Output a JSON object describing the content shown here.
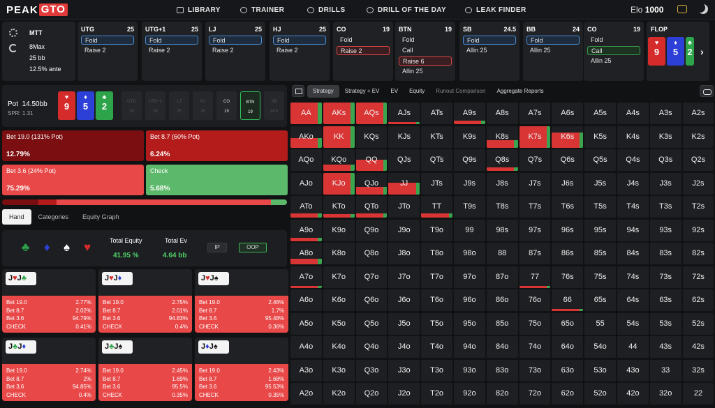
{
  "header": {
    "logo_left": "PEAK",
    "logo_right": "GTO",
    "nav": [
      {
        "label": "LIBRARY",
        "icon": "library-icon"
      },
      {
        "label": "TRAINER",
        "icon": "gamepad-icon"
      },
      {
        "label": "DRILLS",
        "icon": "drills-icon"
      },
      {
        "label": "DRILL OF THE DAY",
        "icon": "plus-circle-icon"
      },
      {
        "label": "LEAK FINDER",
        "icon": "leak-finder-icon"
      }
    ],
    "elo_label": "Elo",
    "elo_value": "1000"
  },
  "game_info": {
    "format": "MTT",
    "players": "8Max",
    "stack": "25 bb",
    "ante": "12.5% ante"
  },
  "seats": [
    {
      "pos": "UTG",
      "stack": "25",
      "actions": [
        {
          "t": "Fold",
          "h": "blue"
        },
        {
          "t": "Raise 2",
          "h": ""
        }
      ]
    },
    {
      "pos": "UTG+1",
      "stack": "25",
      "actions": [
        {
          "t": "Fold",
          "h": "blue"
        },
        {
          "t": "Raise 2",
          "h": ""
        }
      ]
    },
    {
      "pos": "LJ",
      "stack": "25",
      "actions": [
        {
          "t": "Fold",
          "h": "blue"
        },
        {
          "t": "Raise 2",
          "h": ""
        }
      ]
    },
    {
      "pos": "HJ",
      "stack": "25",
      "actions": [
        {
          "t": "Fold",
          "h": "blue"
        },
        {
          "t": "Raise 2",
          "h": ""
        }
      ]
    },
    {
      "pos": "CO",
      "stack": "19",
      "actions": [
        {
          "t": "Fold",
          "h": ""
        },
        {
          "t": "Raise 2",
          "h": "red"
        }
      ]
    },
    {
      "pos": "BTN",
      "stack": "19",
      "actions": [
        {
          "t": "Fold",
          "h": ""
        },
        {
          "t": "Call",
          "h": ""
        },
        {
          "t": "Raise 6",
          "h": "red"
        },
        {
          "t": "Allin 25",
          "h": ""
        }
      ]
    },
    {
      "pos": "SB",
      "stack": "24.5",
      "actions": [
        {
          "t": "Fold",
          "h": "blue"
        },
        {
          "t": "Allin 25",
          "h": ""
        }
      ]
    },
    {
      "pos": "BB",
      "stack": "24",
      "actions": [
        {
          "t": "Fold",
          "h": "blue"
        },
        {
          "t": "Allin 25",
          "h": ""
        }
      ]
    },
    {
      "pos": "CO",
      "stack": "19",
      "actions": [
        {
          "t": "Fold",
          "h": ""
        },
        {
          "t": "Call",
          "h": "green"
        },
        {
          "t": "Allin 25",
          "h": ""
        }
      ]
    }
  ],
  "flop": {
    "label": "FLOP",
    "cards": [
      {
        "rank": "9",
        "suit": "♥",
        "color": "red"
      },
      {
        "rank": "5",
        "suit": "♦",
        "color": "blue"
      },
      {
        "rank": "2",
        "suit": "♣",
        "color": "green"
      }
    ]
  },
  "board": {
    "pot_label": "Pot",
    "pot_value": "14.50bb",
    "spr": "SPR: 1.31",
    "cards": [
      {
        "rank": "9",
        "suit": "♥",
        "color": "red"
      },
      {
        "rank": "5",
        "suit": "♦",
        "color": "blue"
      },
      {
        "rank": "2",
        "suit": "♣",
        "color": "green"
      }
    ],
    "positions": [
      {
        "name": "UTG",
        "stack": "25",
        "state": "dim"
      },
      {
        "name": "UTG+1",
        "stack": "25",
        "state": "dim"
      },
      {
        "name": "LJ",
        "stack": "25",
        "state": "dim"
      },
      {
        "name": "HJ",
        "stack": "25",
        "state": "dim"
      },
      {
        "name": "CO",
        "stack": "19",
        "state": "on"
      },
      {
        "name": "BTN",
        "stack": "19",
        "state": "active"
      },
      {
        "name": "SB",
        "stack": "24.5",
        "state": "dim"
      }
    ]
  },
  "strategies": [
    {
      "label": "Bet 19.0 (131% Pot)",
      "pct": "12.79%",
      "color": "#7a0e10"
    },
    {
      "label": "Bet 8.7 (60% Pot)",
      "pct": "6.24%",
      "color": "#b41c1c"
    },
    {
      "label": "Bet 3.6 (24% Pot)",
      "pct": "75.29%",
      "color": "#e84848"
    },
    {
      "label": "Check",
      "pct": "5.68%",
      "color": "#5cb86a"
    }
  ],
  "hand_tabs": [
    "Hand",
    "Categories",
    "Equity Graph"
  ],
  "hand_summary": {
    "equity_label": "Total Equity",
    "equity_value": "41.95 %",
    "ev_label": "Total Ev",
    "ev_value": "4.64 bb",
    "ip_label": "IP",
    "oop_label": "OOP"
  },
  "combos": [
    {
      "c1": "J",
      "s1": "♥",
      "k1": "r",
      "c2": "J",
      "s2": "♣",
      "k2": "g",
      "rows": [
        [
          "Bet 19.0",
          "2.77%"
        ],
        [
          "Bet 8.7",
          "2.02%"
        ],
        [
          "Bet 3.6",
          "94.79%"
        ],
        [
          "CHECK",
          "0.41%"
        ]
      ]
    },
    {
      "c1": "J",
      "s1": "♥",
      "k1": "r",
      "c2": "J",
      "s2": "♦",
      "k2": "b",
      "rows": [
        [
          "Bet 19.0",
          "2.75%"
        ],
        [
          "Bet 8.7",
          "2.01%"
        ],
        [
          "Bet 3.6",
          "94.83%"
        ],
        [
          "CHECK",
          "0.4%"
        ]
      ]
    },
    {
      "c1": "J",
      "s1": "♥",
      "k1": "r",
      "c2": "J",
      "s2": "♠",
      "k2": "k",
      "rows": [
        [
          "Bet 19.0",
          "2.46%"
        ],
        [
          "Bet 8.7",
          "1.7%"
        ],
        [
          "Bet 3.6",
          "95.48%"
        ],
        [
          "CHECK",
          "0.36%"
        ]
      ]
    },
    {
      "c1": "J",
      "s1": "♣",
      "k1": "g",
      "c2": "J",
      "s2": "♦",
      "k2": "b",
      "rows": [
        [
          "Bet 19.0",
          "2.74%"
        ],
        [
          "Bet 8.7",
          "2%"
        ],
        [
          "Bet 3.6",
          "94.85%"
        ],
        [
          "CHECK",
          "0.4%"
        ]
      ]
    },
    {
      "c1": "J",
      "s1": "♣",
      "k1": "g",
      "c2": "J",
      "s2": "♠",
      "k2": "k",
      "rows": [
        [
          "Bet 19.0",
          "2.45%"
        ],
        [
          "Bet 8.7",
          "1.69%"
        ],
        [
          "Bet 3.6",
          "95.5%"
        ],
        [
          "CHECK",
          "0.35%"
        ]
      ]
    },
    {
      "c1": "J",
      "s1": "♦",
      "k1": "b",
      "c2": "J",
      "s2": "♠",
      "k2": "k",
      "rows": [
        [
          "Bet 19.0",
          "2.43%"
        ],
        [
          "Bet 8.7",
          "1.68%"
        ],
        [
          "Bet 3.6",
          "95.53%"
        ],
        [
          "CHECK",
          "0.35%"
        ]
      ]
    }
  ],
  "right_tabs": [
    {
      "label": "Strategy",
      "state": "on"
    },
    {
      "label": "Strategy + EV",
      "state": ""
    },
    {
      "label": "EV",
      "state": ""
    },
    {
      "label": "Equity",
      "state": ""
    },
    {
      "label": "Runout Comparison",
      "state": "muted"
    },
    {
      "label": "Aggregate Reports",
      "state": ""
    }
  ],
  "matrix": {
    "ranks": [
      "A",
      "K",
      "Q",
      "J",
      "T",
      "9",
      "8",
      "7",
      "6",
      "5",
      "4",
      "3",
      "2"
    ],
    "range": {
      "AA": 1,
      "AKs": 1,
      "AQs": 1,
      "AJs": 0.1,
      "A9s": 0.15,
      "AKo": 0.45,
      "KK": 1,
      "K8s": 0.35,
      "K7s": 1,
      "K6s": 0.7,
      "KQo": 0.3,
      "QQ": 0.5,
      "Q8s": 0.15,
      "KJo": 1,
      "QJo": 0.35,
      "JJ": 0.55,
      "ATo": 0.2,
      "KTo": 0.15,
      "QTo": 0.2,
      "TT": 0.2,
      "A9o": 0.15,
      "A8o": 0.25,
      "A7o": 0.1,
      "77": 0.1,
      "66": 0.1
    }
  }
}
